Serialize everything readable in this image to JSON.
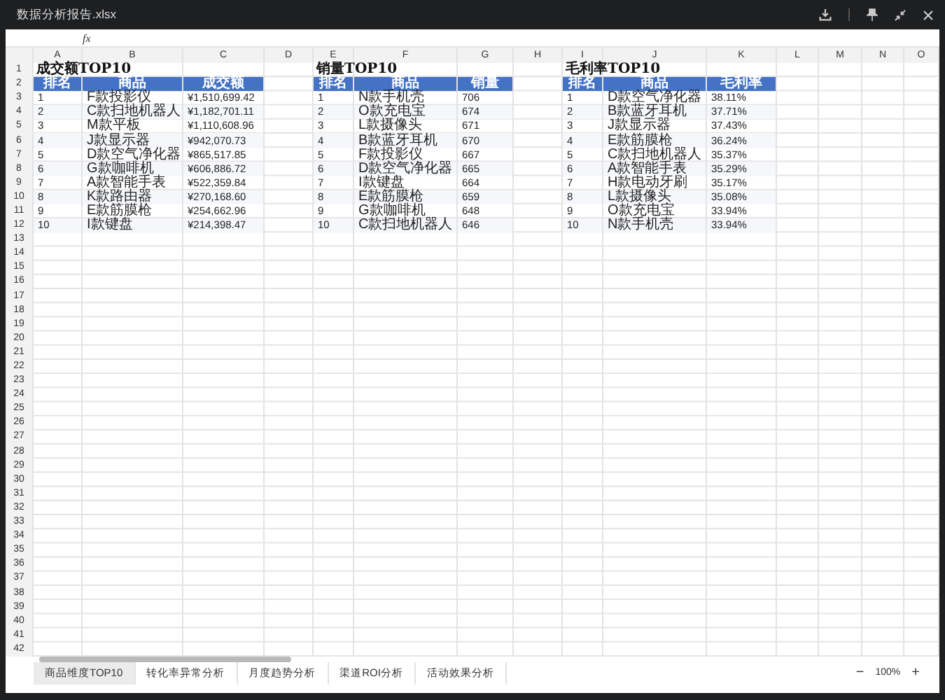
{
  "window": {
    "title": "数据分析报告.xlsx"
  },
  "formula_bar": {
    "label": "fx"
  },
  "columns": [
    "A",
    "B",
    "C",
    "D",
    "E",
    "F",
    "G",
    "H",
    "I",
    "J",
    "K",
    "L",
    "M",
    "N",
    "O"
  ],
  "row_numbers": [
    "1",
    "2",
    "3",
    "4",
    "5",
    "6",
    "7",
    "8",
    "9",
    "10",
    "11",
    "12",
    "13",
    "14",
    "15",
    "16",
    "17",
    "18",
    "19",
    "20",
    "21",
    "22",
    "23",
    "24",
    "25",
    "26",
    "27",
    "28",
    "29",
    "30",
    "31",
    "32",
    "33",
    "34",
    "35",
    "36",
    "37",
    "38",
    "39",
    "40",
    "41",
    "42"
  ],
  "tables": [
    {
      "title": "成交额TOP10",
      "headers": [
        "排名",
        "商品",
        "成交额"
      ],
      "rows": [
        [
          "1",
          "F款投影仪",
          "¥1,510,699.42"
        ],
        [
          "2",
          "C款扫地机器人",
          "¥1,182,701.11"
        ],
        [
          "3",
          "M款平板",
          "¥1,110,608.96"
        ],
        [
          "4",
          "J款显示器",
          "¥942,070.73"
        ],
        [
          "5",
          "D款空气净化器",
          "¥865,517.85"
        ],
        [
          "6",
          "G款咖啡机",
          "¥606,886.72"
        ],
        [
          "7",
          "A款智能手表",
          "¥522,359.84"
        ],
        [
          "8",
          "K款路由器",
          "¥270,168.60"
        ],
        [
          "9",
          "E款筋膜枪",
          "¥254,662.96"
        ],
        [
          "10",
          "I款键盘",
          "¥214,398.47"
        ]
      ]
    },
    {
      "title": "销量TOP10",
      "headers": [
        "排名",
        "商品",
        "销量"
      ],
      "rows": [
        [
          "1",
          "N款手机壳",
          "706"
        ],
        [
          "2",
          "O款充电宝",
          "674"
        ],
        [
          "3",
          "L款摄像头",
          "671"
        ],
        [
          "4",
          "B款蓝牙耳机",
          "670"
        ],
        [
          "5",
          "F款投影仪",
          "667"
        ],
        [
          "6",
          "D款空气净化器",
          "665"
        ],
        [
          "7",
          "I款键盘",
          "664"
        ],
        [
          "8",
          "E款筋膜枪",
          "659"
        ],
        [
          "9",
          "G款咖啡机",
          "648"
        ],
        [
          "10",
          "C款扫地机器人",
          "646"
        ]
      ]
    },
    {
      "title": "毛利率TOP10",
      "headers": [
        "排名",
        "商品",
        "毛利率"
      ],
      "rows": [
        [
          "1",
          "D款空气净化器",
          "38.11%"
        ],
        [
          "2",
          "B款蓝牙耳机",
          "37.71%"
        ],
        [
          "3",
          "J款显示器",
          "37.43%"
        ],
        [
          "4",
          "E款筋膜枪",
          "36.24%"
        ],
        [
          "5",
          "C款扫地机器人",
          "35.37%"
        ],
        [
          "6",
          "A款智能手表",
          "35.29%"
        ],
        [
          "7",
          "H款电动牙刷",
          "35.17%"
        ],
        [
          "8",
          "L款摄像头",
          "35.08%"
        ],
        [
          "9",
          "O款充电宝",
          "33.94%"
        ],
        [
          "10",
          "N款手机壳",
          "33.94%"
        ]
      ]
    }
  ],
  "sheet_tabs": [
    {
      "label": "商品维度TOP10",
      "selected": true
    },
    {
      "label": "转化率异常分析",
      "selected": false
    },
    {
      "label": "月度趋势分析",
      "selected": false
    },
    {
      "label": "渠道ROI分析",
      "selected": false
    },
    {
      "label": "活动效果分析",
      "selected": false
    }
  ],
  "zoom": {
    "minus": "−",
    "value": "100%",
    "plus": "+"
  }
}
